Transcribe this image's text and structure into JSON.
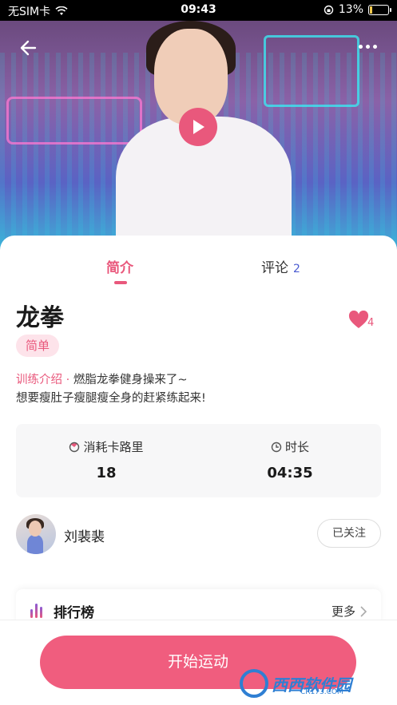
{
  "status_bar": {
    "carrier": "无SIM卡",
    "time": "09:43",
    "battery": "13%",
    "battery_level": 0.13,
    "wifi_icon": "wifi-icon"
  },
  "hero": {
    "back_icon": "back-arrow-icon",
    "more_icon": "more-dots-icon",
    "play_icon": "play-icon",
    "accent_color": "#e9587c"
  },
  "tabs": [
    {
      "label": "简介",
      "active": true
    },
    {
      "label": "评论",
      "count": "2",
      "active": false
    }
  ],
  "workout": {
    "title": "龙拳",
    "favorite_count": "4",
    "level": "简单",
    "intro_label": "训练介绍 · ",
    "intro_text": "燃脂龙拳健身操来了~",
    "intro_text_2": "想要瘦肚子瘦腿瘦全身的赶紧练起来!"
  },
  "stats": {
    "calories_label": "消耗卡路里",
    "calories_value": "18",
    "duration_label": "时长",
    "duration_value": "04:35"
  },
  "coach": {
    "name": "刘裴裴",
    "follow_label": "已关注"
  },
  "ranking": {
    "title": "排行榜",
    "more_label": "更多"
  },
  "bottom": {
    "start_label": "开始运动"
  },
  "watermark": {
    "text": "西西软件园",
    "url": "CR173.COM"
  }
}
